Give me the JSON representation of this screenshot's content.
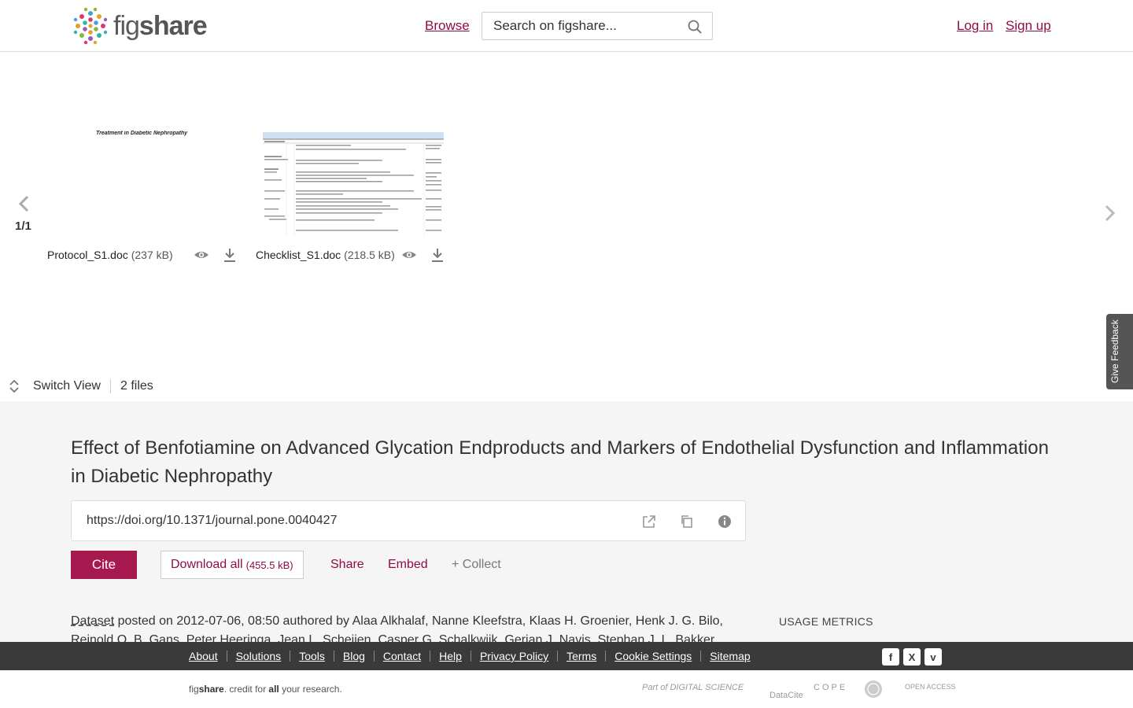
{
  "header": {
    "logo_fig": "fig",
    "logo_share": "share",
    "browse": "Browse",
    "search_placeholder": "Search on figshare...",
    "login": "Log in",
    "signup": "Sign up"
  },
  "viewer": {
    "page_count": "1/1",
    "thumb1_title": "Treatment in Diabetic Nephropathy",
    "files": [
      {
        "name": "Protocol_S1.doc",
        "size": "(237 kB)"
      },
      {
        "name": "Checklist_S1.doc",
        "size": "(218.5 kB)"
      }
    ],
    "switch_view": "Switch View",
    "file_count": "2 files",
    "feedback": "Give Feedback"
  },
  "article": {
    "title": "Effect of Benfotiamine on Advanced Glycation Endproducts and Markers of Endothelial Dysfunction and Inflammation in Diabetic Nephropathy",
    "doi": "https://doi.org/10.1371/journal.pone.0040427",
    "cite": "Cite",
    "download_all": "Download all",
    "download_size": "(455.5 kB)",
    "share": "Share",
    "embed": "Embed",
    "collect": "+ Collect",
    "type": "Dataset",
    "posted_text": " posted on 2012-07-06, 08:50 authored by Alaa Alkhalaf, Nanne Kleefstra, Klaas H. Groenier, Henk J. G. Bilo, Reinold O. B. Gans, Peter Heeringa, Jean L. Scheijen, Casper G. Schalkwijk, Gerjan J. Navis, Stephan J. L. Bakker",
    "usage_metrics": "USAGE METRICS"
  },
  "footer": {
    "links": [
      "About",
      "Solutions",
      "Tools",
      "Blog",
      "Contact",
      "Help",
      "Privacy Policy",
      "Terms",
      "Cookie Settings",
      "Sitemap"
    ],
    "social": [
      "f",
      "X",
      "v"
    ],
    "tag_fig": "fig",
    "tag_share": "share",
    "tag_mid": ". credit for ",
    "tag_all": "all",
    "tag_end": " your research.",
    "partners": [
      "Part of DIGITAL SCIENCE",
      "DataCite",
      "COPE",
      "OPEN ACCESS"
    ]
  },
  "colors": {
    "brand": "#a6194f",
    "link": "#8f0d47",
    "footer_bg": "#3a3a3a"
  }
}
